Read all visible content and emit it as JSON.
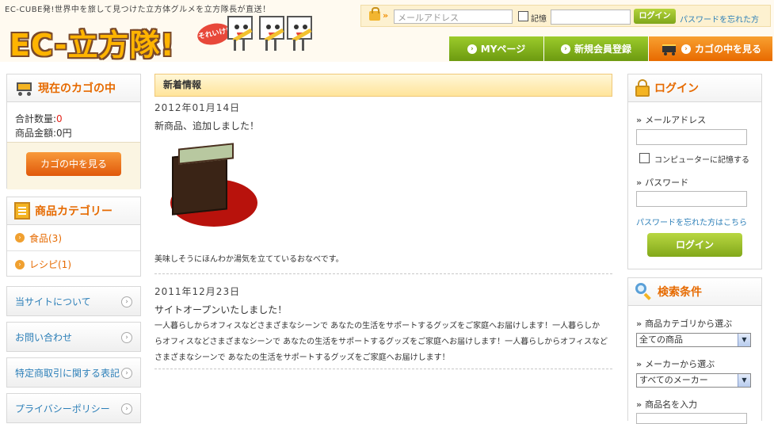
{
  "header": {
    "tagline": "EC-CUBE発!世界中を旅して見つけた立方体グルメを立方隊長が直送！",
    "logo_text": "EC-立方隊!",
    "logo_badge": "それいけ!",
    "login": {
      "email_placeholder": "メールアドレス",
      "remember_label": "記憶",
      "button_label": "ログイン",
      "forgot_label": "パスワードを忘れた方"
    },
    "nav": {
      "mypage": "MYページ",
      "register": "新規会員登録",
      "cart": "カゴの中を見る"
    }
  },
  "cart_box": {
    "title": "現在のカゴの中",
    "quantity_label": "合計数量:",
    "quantity_value": "0",
    "amount_label": "商品金額:",
    "amount_value": "0円",
    "button_label": "カゴの中を見る"
  },
  "category_box": {
    "title": "商品カテゴリー",
    "items": [
      {
        "label": "食品(3)"
      },
      {
        "label": "レシピ(1)"
      }
    ]
  },
  "side_links": [
    {
      "label": "当サイトについて"
    },
    {
      "label": "お問い合わせ"
    },
    {
      "label": "特定商取引に関する表記"
    },
    {
      "label": "プライバシーポリシー"
    }
  ],
  "news": {
    "title": "新着情報",
    "entries": [
      {
        "date": "2012年01月14日",
        "headline": "新商品、追加しました！",
        "body": "美味しそうにほんわか湯気を立てているおなべです。"
      },
      {
        "date": "2011年12月23日",
        "headline": "サイトオープンいたしました！",
        "body_lines": [
          "一人暮らしからオフィスなどさまざまなシーンで あなたの生活をサポートするグッズをご家庭へお届けします！一人暮らしか",
          "らオフィスなどさまざまなシーンで あなたの生活をサポートするグッズをご家庭へお届けします！一人暮らしからオフィスなど",
          "さまざまなシーンで あなたの生活をサポートするグッズをご家庭へお届けします！"
        ]
      }
    ]
  },
  "login_box": {
    "title": "ログイン",
    "email_label": "メールアドレス",
    "remember_label": "コンピューターに記憶する",
    "password_label": "パスワード",
    "forgot_label": "パスワードを忘れた方はこちら",
    "button_label": "ログイン"
  },
  "search_box": {
    "title": "検索条件",
    "category_label": "商品カテゴリから選ぶ",
    "category_selected": "全ての商品",
    "maker_label": "メーカーから選ぶ",
    "maker_selected": "すべてのメーカー",
    "name_label": "商品名を入力"
  },
  "colors": {
    "accent_orange": "#e66a00",
    "nav_green": "#7fa61b",
    "link_blue": "#2c7fb8",
    "price_red": "#e2231a"
  }
}
